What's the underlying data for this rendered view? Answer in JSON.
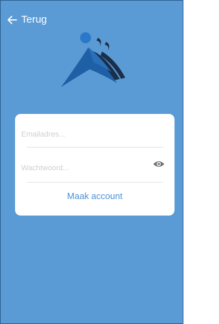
{
  "header": {
    "back_label": "Terug",
    "back_icon": "arrow-left-icon"
  },
  "logo": {
    "icon": "people-logo",
    "colors": {
      "primary": "#1f5fa6",
      "secondary": "#1b2e4a"
    }
  },
  "login_form": {
    "email_placeholder": "Emailadres...",
    "email_value": "",
    "password_placeholder": "Wachtwoord...",
    "password_value": "",
    "show_password_icon": "eye-icon",
    "create_account_label": "Maak account"
  },
  "colors": {
    "background": "#5b9bd5",
    "card": "#ffffff",
    "link": "#4a90d9",
    "placeholder": "#d0d0d0"
  }
}
